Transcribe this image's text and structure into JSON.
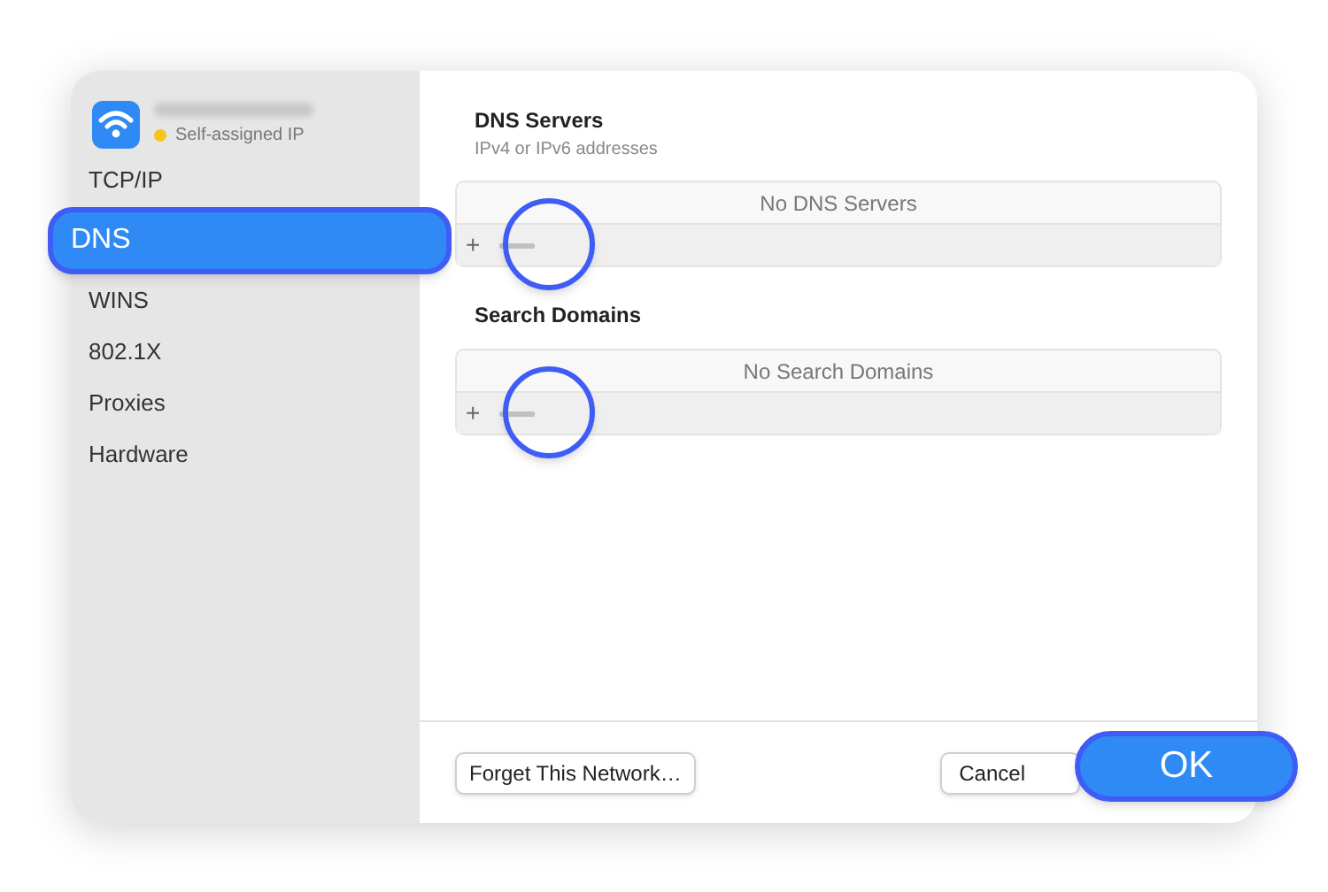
{
  "network": {
    "status": "Self-assigned IP",
    "color": "#f5c518"
  },
  "sidebar": {
    "items": [
      {
        "label": "TCP/IP",
        "selected": false
      },
      {
        "label": "DNS",
        "selected": true
      },
      {
        "label": "WINS",
        "selected": false
      },
      {
        "label": "802.1X",
        "selected": false
      },
      {
        "label": "Proxies",
        "selected": false
      },
      {
        "label": "Hardware",
        "selected": false
      }
    ]
  },
  "sections": [
    {
      "title": "DNS Servers",
      "subtitle": "IPv4 or IPv6 addresses",
      "empty_text": "No DNS Servers",
      "add": "+"
    },
    {
      "title": "Search Domains",
      "empty_text": "No Search Domains",
      "add": "+"
    }
  ],
  "buttons": {
    "forget": "Forget This Network…",
    "cancel": "Cancel",
    "ok": "OK"
  }
}
